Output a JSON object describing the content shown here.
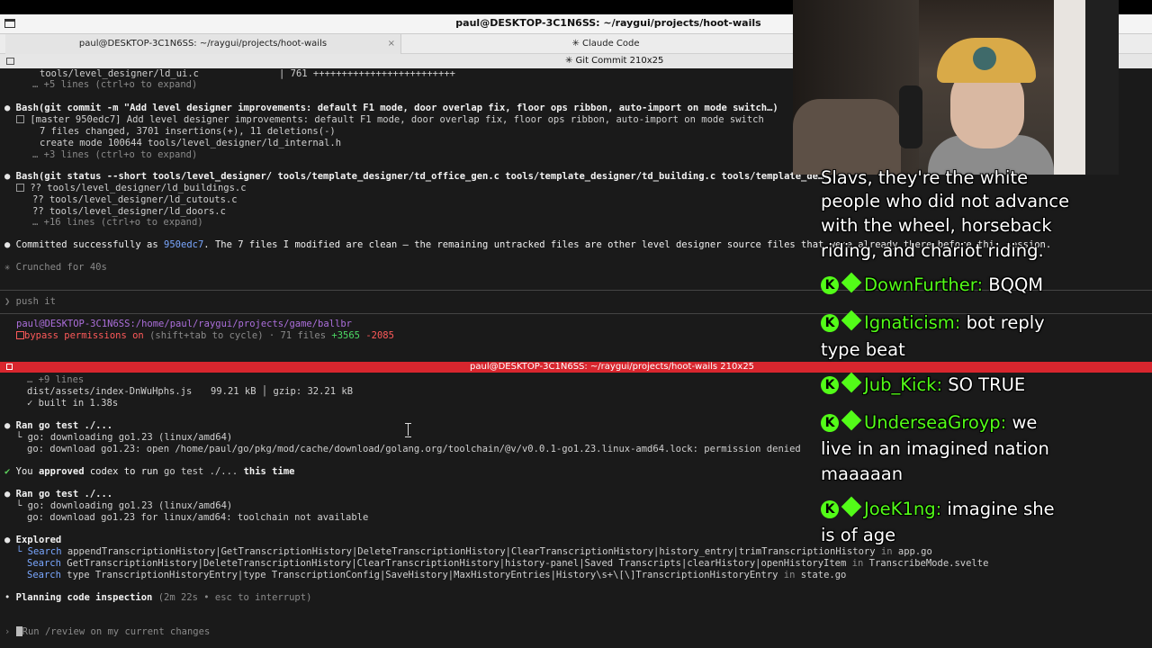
{
  "window": {
    "title": "paul@DESKTOP-3C1N6SS: ~/raygui/projects/hoot-wails"
  },
  "tabs": [
    {
      "label": "paul@DESKTOP-3C1N6SS: ~/raygui/projects/hoot-wails"
    },
    {
      "label": "✳ Claude Code"
    }
  ],
  "top_strip": {
    "label": "✳ Git Commit 210x25"
  },
  "pane1": {
    "l1_file": "tools/level_designer/ld_ui.c",
    "l1_stat": "| 761 +++++++++++++++++++++++++",
    "l2": "… +5 lines (ctrl+o to expand)",
    "l3_cmd": "Bash(git commit -m \"Add level designer improvements: default F1 mode, door overlap fix, floor ops ribbon, auto-import on mode switch…)",
    "l4": "[master 950edc7] Add level designer improvements: default F1 mode, door overlap fix, floor ops ribbon, auto-import on mode switch",
    "l5": "7 files changed, 3701 insertions(+), 11 deletions(-)",
    "l6": "create mode 100644 tools/level_designer/ld_internal.h",
    "l7": "… +3 lines (ctrl+o to expand)",
    "l8_cmd": "Bash(git status --short tools/level_designer/ tools/template_designer/td_office_gen.c tools/template_designer/td_building.c tools/template_de…",
    "l9": "?? tools/level_designer/ld_buildings.c",
    "l10": "?? tools/level_designer/ld_cutouts.c",
    "l11": "?? tools/level_designer/ld_doors.c",
    "l12": "… +16 lines (ctrl+o to expand)",
    "l13_a": "Committed successfully as",
    "l13_hash": "950edc7",
    "l13_b": ". The 7 files I modified are clean — the remaining untracked files are other level designer source files that were already there before this session.",
    "l14": "✳ Crunched for 40s",
    "prompt": "push it",
    "status_path_user": "paul@DESKTOP-3C1N6SS",
    "status_path": ":/home/paul/raygui/projects/game/ballbr",
    "status_mode": "bypass permissions on",
    "status_rest": "(shift+tab to cycle) · 71 files",
    "status_plus": "+3565",
    "status_minus": "-2085"
  },
  "pane_bar": {
    "label": "paul@DESKTOP-3C1N6SS: ~/raygui/projects/hoot-wails 210x25"
  },
  "pane2": {
    "l1": "… +9 lines",
    "l2_file": "dist/assets/index-DnWuHphs.js",
    "l2_size": "99.21 kB │ gzip: 32.21 kB",
    "l3": "✓ built in 1.38s",
    "l4": "Ran go test ./...",
    "l5": "└ go: downloading go1.23 (linux/amd64)",
    "l6": "go: download go1.23: open /home/paul/go/pkg/mod/cache/download/golang.org/toolchain/@v/v0.0.1-go1.23.linux-amd64.lock: permission denied",
    "l7_a": "You",
    "l7_b": "approved",
    "l7_c": "codex to run",
    "l7_cmd": "go test ./...",
    "l7_d": "this time",
    "l8": "Ran go test ./...",
    "l9": "└ go: downloading go1.23 (linux/amd64)",
    "l10": "go: download go1.23 for linux/amd64: toolchain not available",
    "l11": "Explored",
    "l12_kw": "└ Search",
    "l12": "appendTranscriptionHistory|GetTranscriptionHistory|DeleteTranscriptionHistory|ClearTranscriptionHistory|history_entry|trimTranscriptionHistory",
    "l12_in": "in",
    "l12_file": "app.go",
    "l13_kw": "Search",
    "l13": "GetTranscriptionHistory|DeleteTranscriptionHistory|ClearTranscriptionHistory|history-panel|Saved Transcripts|clearHistory|openHistoryItem",
    "l13_in": "in",
    "l13_file": "TranscribeMode.svelte",
    "l14_kw": "Search",
    "l14": "type TranscriptionHistoryEntry|type TranscriptionConfig|SaveHistory|MaxHistoryEntries|History\\s+\\[\\]TranscriptionHistoryEntry",
    "l14_in": "in",
    "l14_file": "state.go",
    "l15_a": "Planning code inspection",
    "l15_b": "(2m 22s • esc to interrupt)",
    "input_placeholder": "Run /review on my current changes"
  },
  "chat": {
    "overflow_lines": [
      "Slavs, they're the white",
      "people who did not advance",
      "with the wheel, horseback",
      "riding, and chariot riding."
    ],
    "messages": [
      {
        "user": "DownFurther:",
        "text": "BQQM"
      },
      {
        "user": "Ignaticism:",
        "text": "bot reply",
        "cont": "type beat"
      },
      {
        "user": "Jub_Kick:",
        "text": "SO TRUE"
      },
      {
        "user": "UnderseaGroyp:",
        "text": "we",
        "cont": "live in an imagined nation",
        "cont2": "maaaaan"
      },
      {
        "user": "JoeK1ng:",
        "text": "imagine she",
        "cont": "is of age"
      }
    ],
    "badge_letter": "K",
    "badge_color": "#53fc18"
  }
}
